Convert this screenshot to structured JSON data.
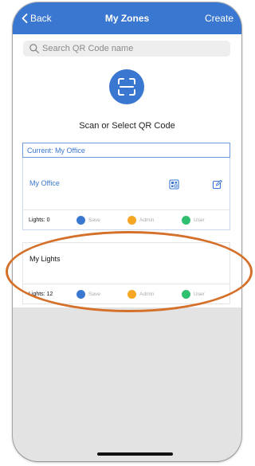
{
  "navbar": {
    "back_label": "Back",
    "title": "My Zones",
    "create_label": "Create",
    "background_color": "#3a77d0"
  },
  "search": {
    "placeholder": "Search QR Code name",
    "value": ""
  },
  "scan": {
    "icon": "qr-scan-icon",
    "label": "Scan or Select QR Code"
  },
  "current_header": "Current: My Office",
  "zones": [
    {
      "name": "My Office",
      "lights_label": "Lights: 0",
      "actions": [
        {
          "label": "Save",
          "color": "#3a77d0"
        },
        {
          "label": "Admin",
          "color": "#f5a623"
        },
        {
          "label": "User",
          "color": "#2fbf71"
        }
      ]
    },
    {
      "name": "My Lights",
      "lights_label": "Lights: 12",
      "actions": [
        {
          "label": "Save",
          "color": "#3a77d0"
        },
        {
          "label": "Admin",
          "color": "#f5a623"
        },
        {
          "label": "User",
          "color": "#2fbf71"
        }
      ]
    }
  ],
  "highlight_color": "#d4702a"
}
